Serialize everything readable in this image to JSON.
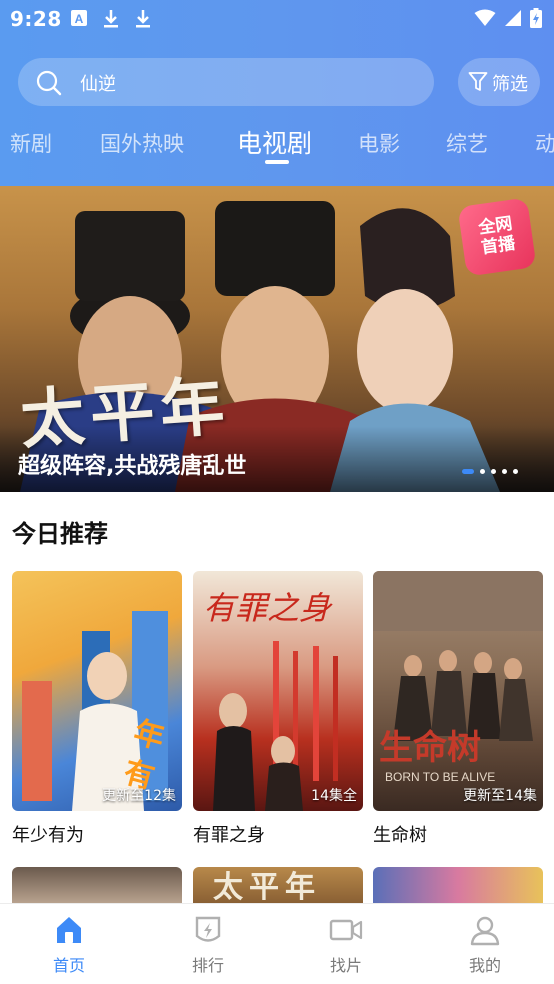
{
  "status_bar": {
    "time": "9:28"
  },
  "search": {
    "query": "仙逆",
    "icon": "search-icon"
  },
  "filter": {
    "label": "筛选",
    "icon": "filter-icon"
  },
  "tabs": [
    {
      "label": "新剧",
      "active": false
    },
    {
      "label": "国外热映",
      "active": false
    },
    {
      "label": "电视剧",
      "active": true
    },
    {
      "label": "电影",
      "active": false
    },
    {
      "label": "综艺",
      "active": false
    },
    {
      "label": "动",
      "active": false
    }
  ],
  "banner": {
    "title_art": "太平年",
    "badge": [
      "全网",
      "首播"
    ],
    "caption": "超级阵容,共战残唐乱世",
    "slide_count": 5,
    "active_slide": 1
  },
  "section": {
    "title": "今日推荐"
  },
  "recommendations": [
    {
      "title": "年少有为",
      "note": "更新至12集",
      "poster_text": "年少有为",
      "accent": "#3a6fc4"
    },
    {
      "title": "有罪之身",
      "note": "14集全",
      "poster_text": "有罪之身",
      "accent": "#c23a2e"
    },
    {
      "title": "生命树",
      "note": "更新至14集",
      "poster_text": "生命树",
      "accent": "#7a5a3e"
    }
  ],
  "bottom_nav": [
    {
      "label": "首页",
      "icon": "home-icon",
      "active": true
    },
    {
      "label": "排行",
      "icon": "ranking-icon",
      "active": false
    },
    {
      "label": "找片",
      "icon": "video-camera-icon",
      "active": false
    },
    {
      "label": "我的",
      "icon": "user-icon",
      "active": false
    }
  ],
  "colors": {
    "accent": "#3d8af7",
    "header_gradient_start": "#5a9bf0",
    "header_gradient_end": "#5e8ff0"
  }
}
